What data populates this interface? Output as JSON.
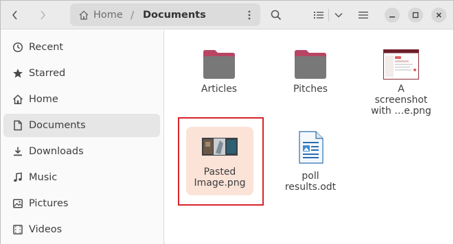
{
  "window": {
    "nav": {
      "back_icon": "chevron-left-icon",
      "forward_icon": "chevron-right-icon"
    },
    "pathbar": {
      "home_label": "Home",
      "separator": "/",
      "current_label": "Documents"
    },
    "toolbar": {
      "search_icon": "search-icon",
      "list_view_icon": "list-view-icon",
      "view_options_icon": "chevron-down-icon",
      "menu_icon": "hamburger-menu-icon"
    },
    "window_controls": [
      "minimize",
      "maximize",
      "close"
    ]
  },
  "sidebar": {
    "items": [
      {
        "label": "Recent",
        "icon": "clock-icon",
        "active": false
      },
      {
        "label": "Starred",
        "icon": "star-icon",
        "active": false
      },
      {
        "label": "Home",
        "icon": "home-icon",
        "active": false
      },
      {
        "label": "Documents",
        "icon": "document-icon",
        "active": true
      },
      {
        "label": "Downloads",
        "icon": "download-icon",
        "active": false
      },
      {
        "label": "Music",
        "icon": "music-note-icon",
        "active": false
      },
      {
        "label": "Pictures",
        "icon": "picture-icon",
        "active": false
      },
      {
        "label": "Videos",
        "icon": "video-icon",
        "active": false
      }
    ]
  },
  "files": [
    {
      "name_lines": [
        "Articles"
      ],
      "type": "folder"
    },
    {
      "name_lines": [
        "Pitches"
      ],
      "type": "folder"
    },
    {
      "name_lines": [
        "A",
        "screenshot",
        "with …e.png"
      ],
      "type": "image"
    },
    {
      "name_lines": [
        "Pasted",
        "Image.png"
      ],
      "type": "image",
      "selected": true
    },
    {
      "name_lines": [
        "poll",
        "results.odt"
      ],
      "type": "document"
    }
  ],
  "colors": {
    "folder_tab": "#b84564",
    "folder_body": "#787878",
    "selection_bg": "#fbe3d8",
    "highlight_box": "#d6232a"
  }
}
